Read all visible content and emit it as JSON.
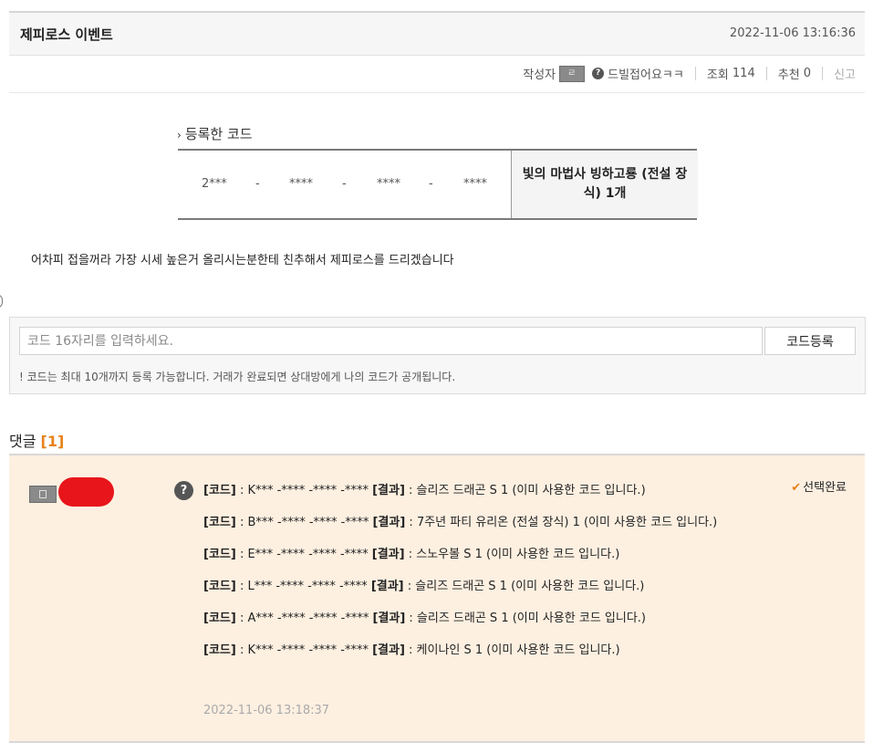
{
  "post": {
    "title": "제피로스 이벤트",
    "date": "2022-11-06 13:16:36",
    "author_label": "작성자",
    "author_name": "드빌접어요ㅋㅋ",
    "views_label": "조회",
    "views": "114",
    "likes_label": "추천",
    "likes": "0",
    "report_label": "신고"
  },
  "code_section": {
    "title": "등록한 코드",
    "code_parts": [
      "2***",
      "-",
      "****",
      "-",
      "****",
      "-",
      "****"
    ],
    "reward": "빛의 마법사 빙하고룡 (전설 장식) 1개"
  },
  "body_text": "어차피 접을꺼라 가장 시세 높은거 올리시는분한테 친추해서 제피로스를 드리겠습니다",
  "register": {
    "placeholder": "코드 16자리를 입력하세요.",
    "button": "코드등록",
    "note": "! 코드는 최대 10개까지 등록 가능합니다. 거래가 완료되면 상대방에게 나의 코드가 공개됩니다."
  },
  "comments": {
    "heading": "댓글",
    "count": "[1]",
    "items": [
      {
        "selected_label": "선택완료",
        "date": "2022-11-06 13:18:37",
        "code_label": "[코드]",
        "result_label": "[결과]",
        "lines": [
          {
            "code": " : K*** -**** -**** -**** ",
            "result": " : 슬리즈 드래곤 S 1 (이미 사용한 코드 입니다.)"
          },
          {
            "code": " : B*** -**** -**** -**** ",
            "result": " : 7주년 파티 유리온 (전설 장식) 1 (이미 사용한 코드 입니다.)"
          },
          {
            "code": " : E*** -**** -**** -**** ",
            "result": " : 스노우볼 S 1 (이미 사용한 코드 입니다.)"
          },
          {
            "code": " : L*** -**** -**** -**** ",
            "result": " : 슬리즈 드래곤 S 1 (이미 사용한 코드 입니다.)"
          },
          {
            "code": " : A*** -**** -**** -**** ",
            "result": " : 슬리즈 드래곤 S 1 (이미 사용한 코드 입니다.)"
          },
          {
            "code": " : K*** -**** -**** -**** ",
            "result": " : 케이나인 S 1 (이미 사용한 코드 입니다.)"
          }
        ]
      }
    ]
  }
}
